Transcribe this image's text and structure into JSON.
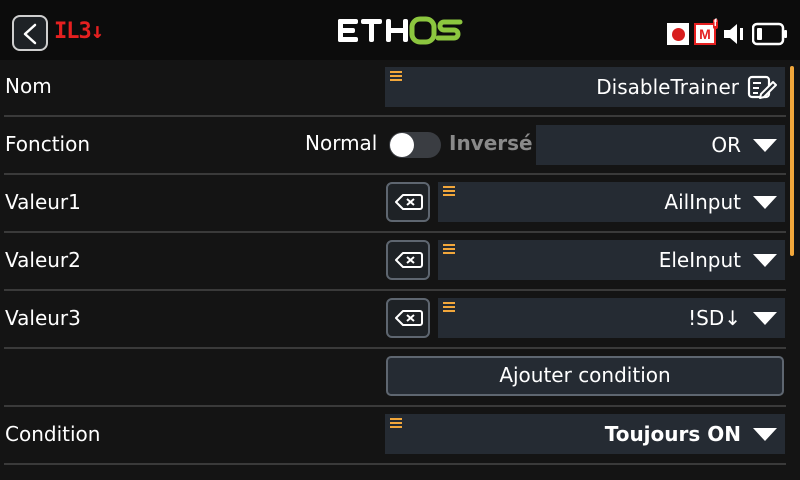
{
  "header": {
    "model": "IL3↓",
    "logo": "ETHOS",
    "icons": [
      "back-icon",
      "record-icon",
      "mf-icon",
      "speaker-icon",
      "battery-icon"
    ],
    "colors": {
      "accent": "#f2a73b",
      "logo_green": "#8cc63f",
      "alert_red": "#e52020"
    }
  },
  "rows": {
    "name": {
      "label": "Nom",
      "value": "DisableTrainer"
    },
    "function": {
      "label": "Fonction",
      "normal": "Normal",
      "inverse": "Inversé",
      "value": "OR",
      "inverted": false
    },
    "value1": {
      "label": "Valeur1",
      "value": "AilInput"
    },
    "value2": {
      "label": "Valeur2",
      "value": "EleInput"
    },
    "value3": {
      "label": "Valeur3",
      "value": "!SD↓"
    },
    "add": {
      "label": "Ajouter condition"
    },
    "condition": {
      "label": "Condition",
      "value": "Toujours ON"
    }
  }
}
